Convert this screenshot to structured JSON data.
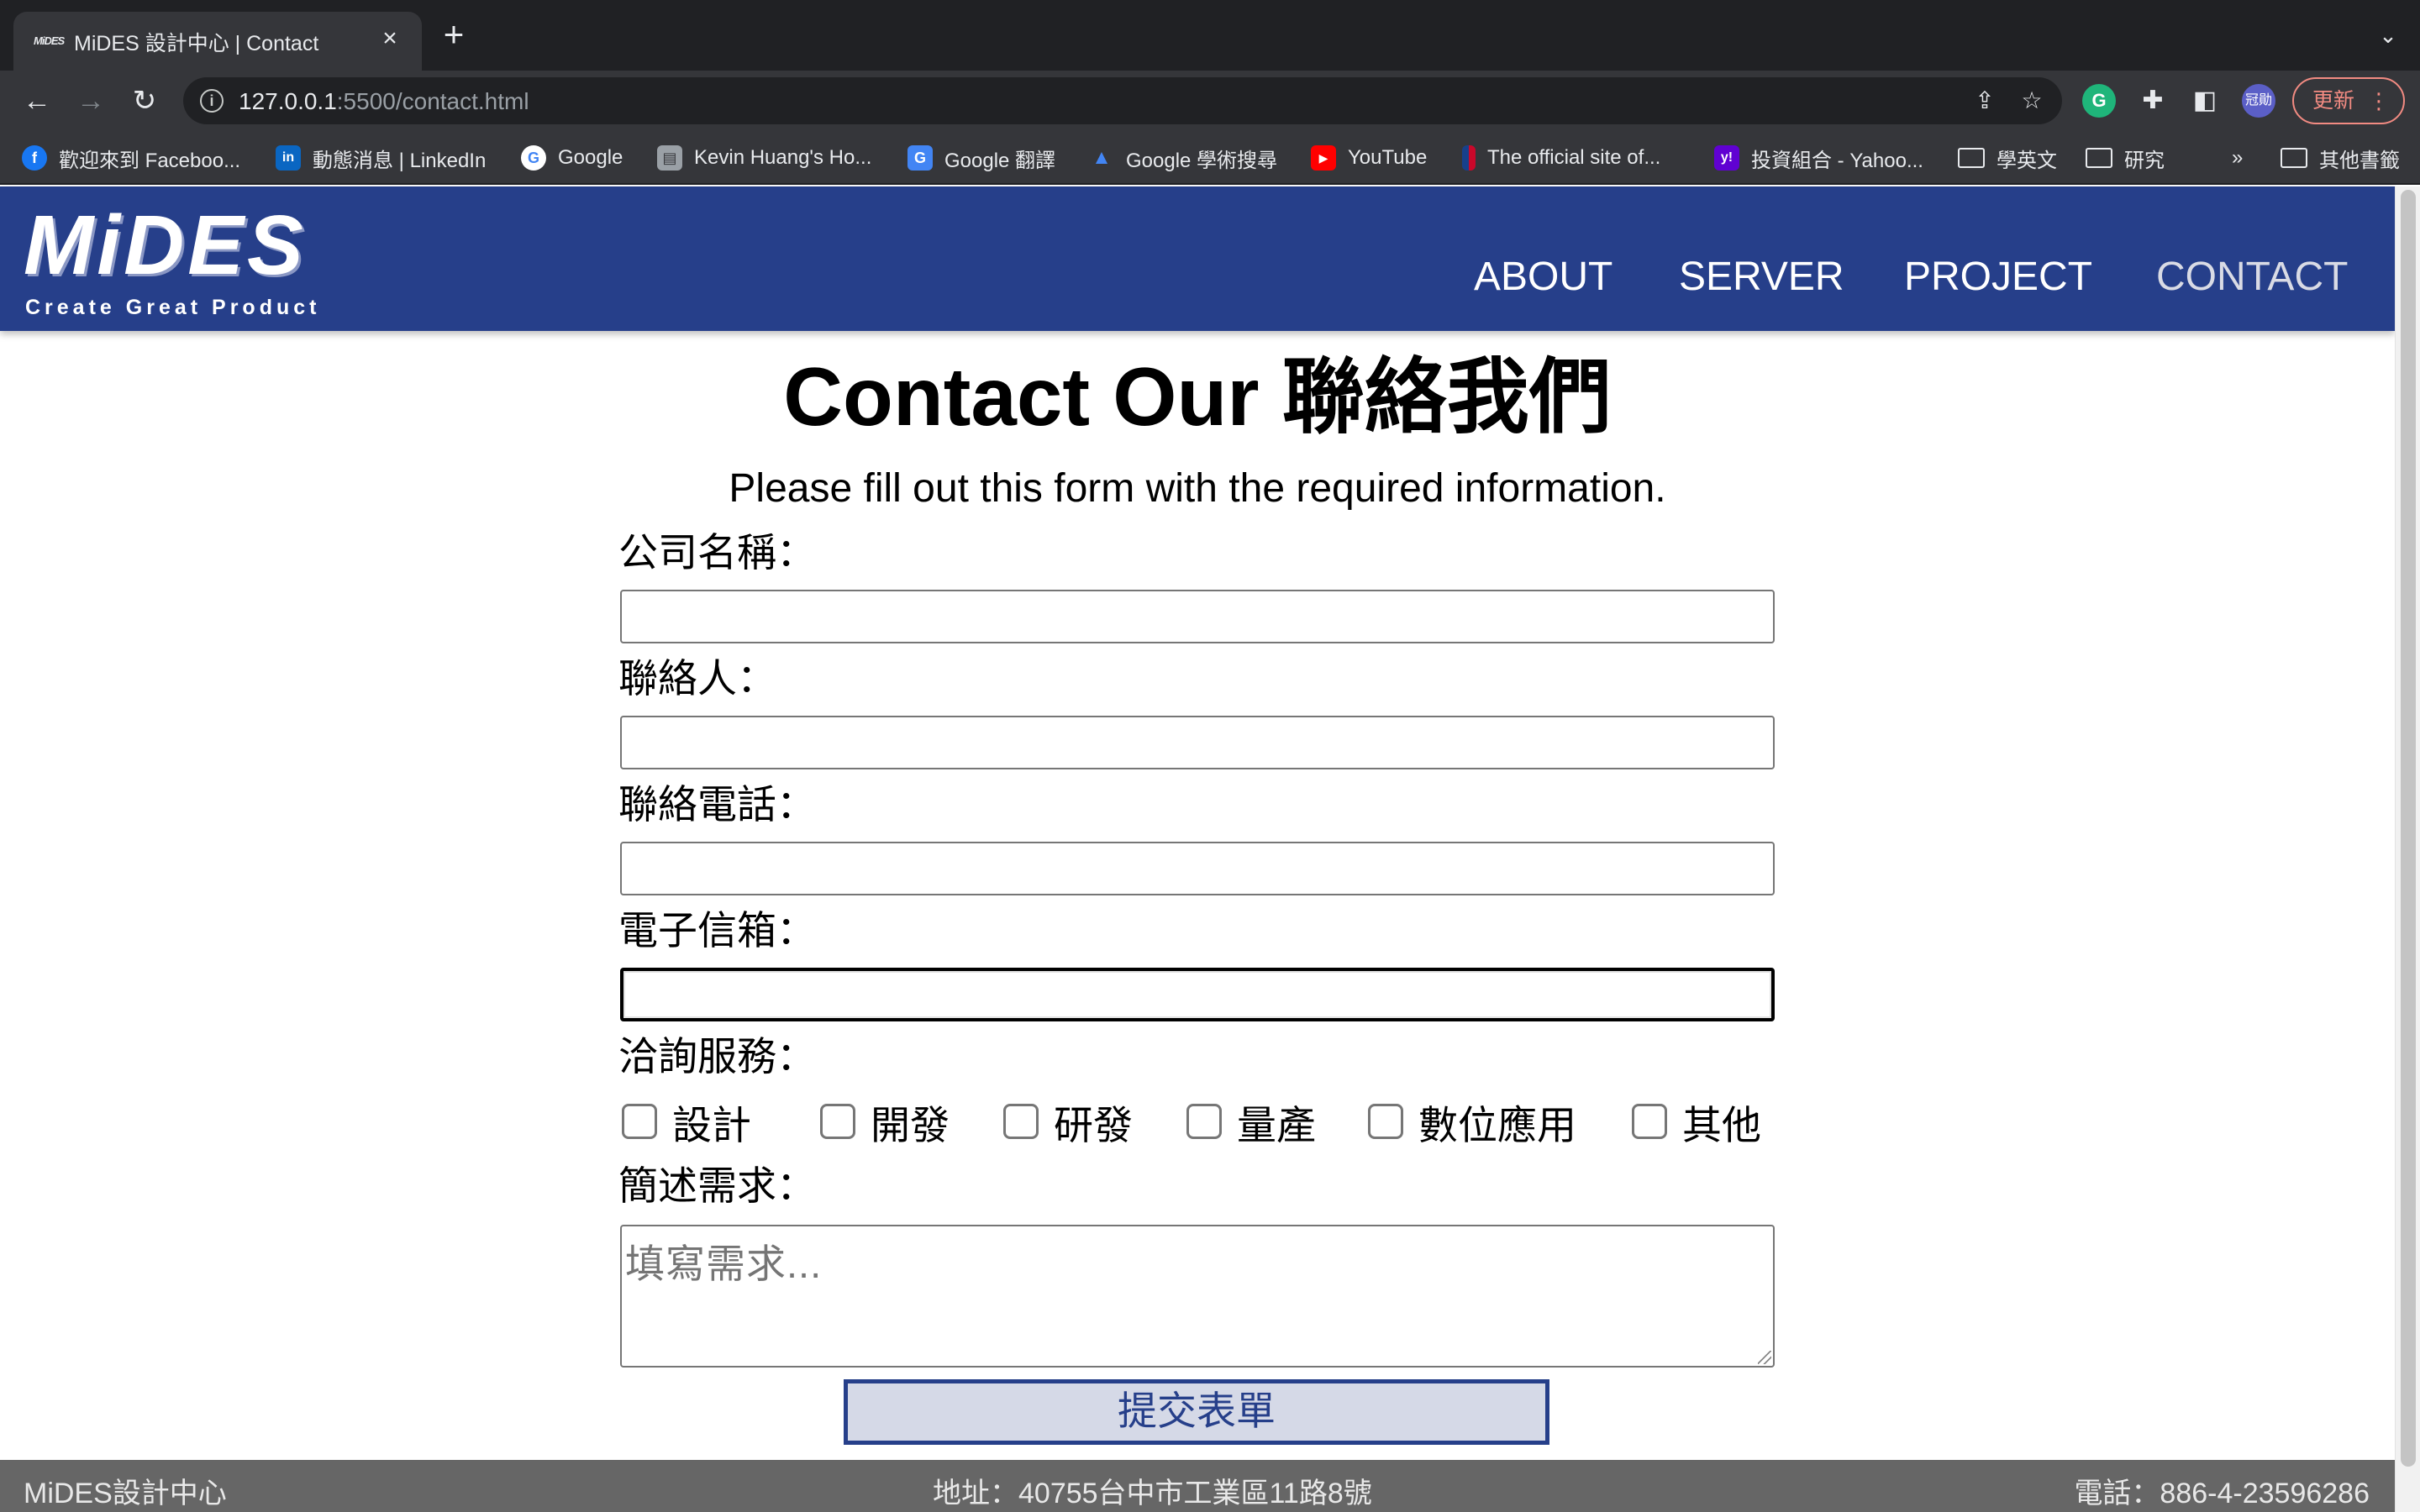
{
  "browser": {
    "tab_title": "MiDES 設計中心 | Contact",
    "tab_favicon_text": "MiDES",
    "url_host": "127.0.0.1",
    "url_rest": ":5500/contact.html",
    "profile_initials": "冠勛",
    "update_label": "更新",
    "bookmarks": [
      {
        "label": "歡迎來到 Faceboo...",
        "icon": "facebook-icon",
        "color": "#1877f2",
        "glyph": "f"
      },
      {
        "label": "動態消息 | LinkedIn",
        "icon": "linkedin-icon",
        "color": "#0a66c2",
        "glyph": "in"
      },
      {
        "label": "Google",
        "icon": "google-icon",
        "color": "#ffffff",
        "glyph": "G"
      },
      {
        "label": "Kevin Huang's Ho...",
        "icon": "save-icon",
        "color": "#5f6368",
        "glyph": "▤"
      },
      {
        "label": "Google 翻譯",
        "icon": "translate-icon",
        "color": "#4285f4",
        "glyph": "G"
      },
      {
        "label": "Google 學術搜尋",
        "icon": "scholar-icon",
        "color": "#4285f4",
        "glyph": "▲"
      },
      {
        "label": "YouTube",
        "icon": "youtube-icon",
        "color": "#ff0000",
        "glyph": "▶"
      },
      {
        "label": "The official site of...",
        "icon": "nba-icon",
        "color": "#c9082a",
        "glyph": "|"
      },
      {
        "label": "投資組合 - Yahoo...",
        "icon": "yahoo-icon",
        "color": "#6001d2",
        "glyph": "y!"
      },
      {
        "label": "學英文",
        "icon": "folder-icon"
      },
      {
        "label": "研究",
        "icon": "folder-icon"
      }
    ],
    "more_label": "»",
    "other_bookmarks": "其他書籤"
  },
  "site": {
    "logo_word": "MiDES",
    "logo_tagline": "Create  Great  Product",
    "nav": [
      {
        "label": "ABOUT"
      },
      {
        "label": "SERVER"
      },
      {
        "label": "PROJECT"
      },
      {
        "label": "CONTACT",
        "active": true
      }
    ],
    "brand_color": "#263f8a"
  },
  "form": {
    "title": "Contact Our 聯絡我們",
    "subtitle": "Please fill out this form with the required information.",
    "company_label": "公司名稱：",
    "company_value": "",
    "contact_label": "聯絡人：",
    "contact_value": "",
    "phone_label": "聯絡電話：",
    "phone_value": "",
    "email_label": "電子信箱：",
    "email_value": "",
    "services_label": "洽詢服務：",
    "services": [
      {
        "label": "設計",
        "checked": false
      },
      {
        "label": "開發",
        "checked": false
      },
      {
        "label": "研發",
        "checked": false
      },
      {
        "label": "量產",
        "checked": false
      },
      {
        "label": "數位應用",
        "checked": false
      },
      {
        "label": "其他",
        "checked": false
      }
    ],
    "needs_label": "簡述需求：",
    "needs_placeholder": "填寫需求...",
    "submit_label": "提交表單"
  },
  "footer": {
    "name": "MiDES設計中心",
    "address": "地址：40755台中市工業區11路8號",
    "phone": "電話：886-4-23596286"
  }
}
